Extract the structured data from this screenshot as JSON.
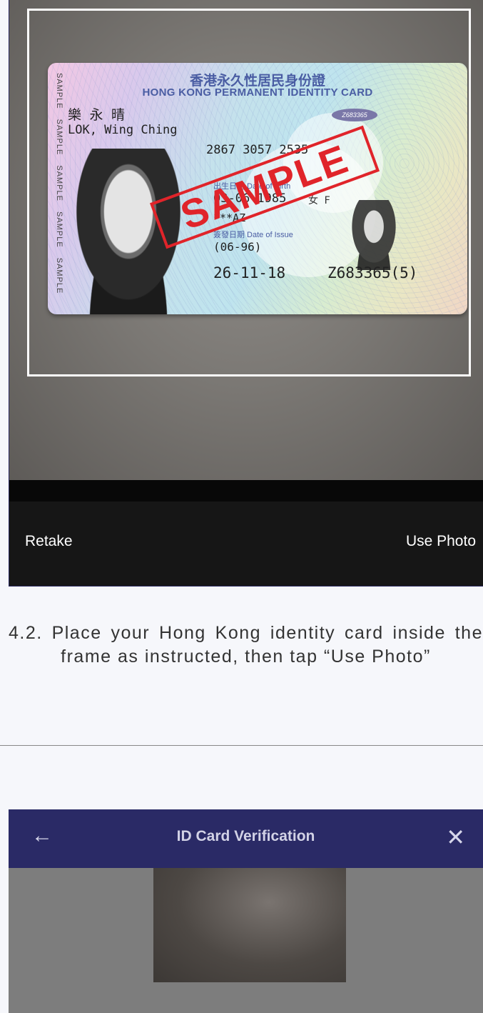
{
  "card": {
    "title_cn": "香港永久性居民身份證",
    "title_en": "HONG KONG PERMANENT IDENTITY CARD",
    "side_text": "SAMPLE SAMPLE SAMPLE SAMPLE SAMPLE",
    "name_cn": "樂 永 晴",
    "name_en": "LOK, Wing Ching",
    "ccc": "2867 3057 2535",
    "dob_label": "出生日期 Date of Birth",
    "dob": "03-06-1985",
    "sex": "女 F",
    "symbols": "***AZ",
    "issue_label": "簽發日期 Date of Issue",
    "first_issue": "(06-96)",
    "issue_date": "26-11-18",
    "hkid": "Z683365(5)",
    "chip_text": "Z683365",
    "stamp": "SAMPLE"
  },
  "toolbar": {
    "retake": "Retake",
    "use_photo": "Use Photo"
  },
  "instruction": "4.2. Place your Hong Kong identity card inside the frame as instructed, then tap “Use Photo”",
  "screen2": {
    "title": "ID Card Verification",
    "back_icon": "←",
    "close_icon": "✕"
  },
  "colors": {
    "nav_bar": "#2a2a66",
    "stamp_red": "#e0242a",
    "toolbar": "#161616"
  }
}
